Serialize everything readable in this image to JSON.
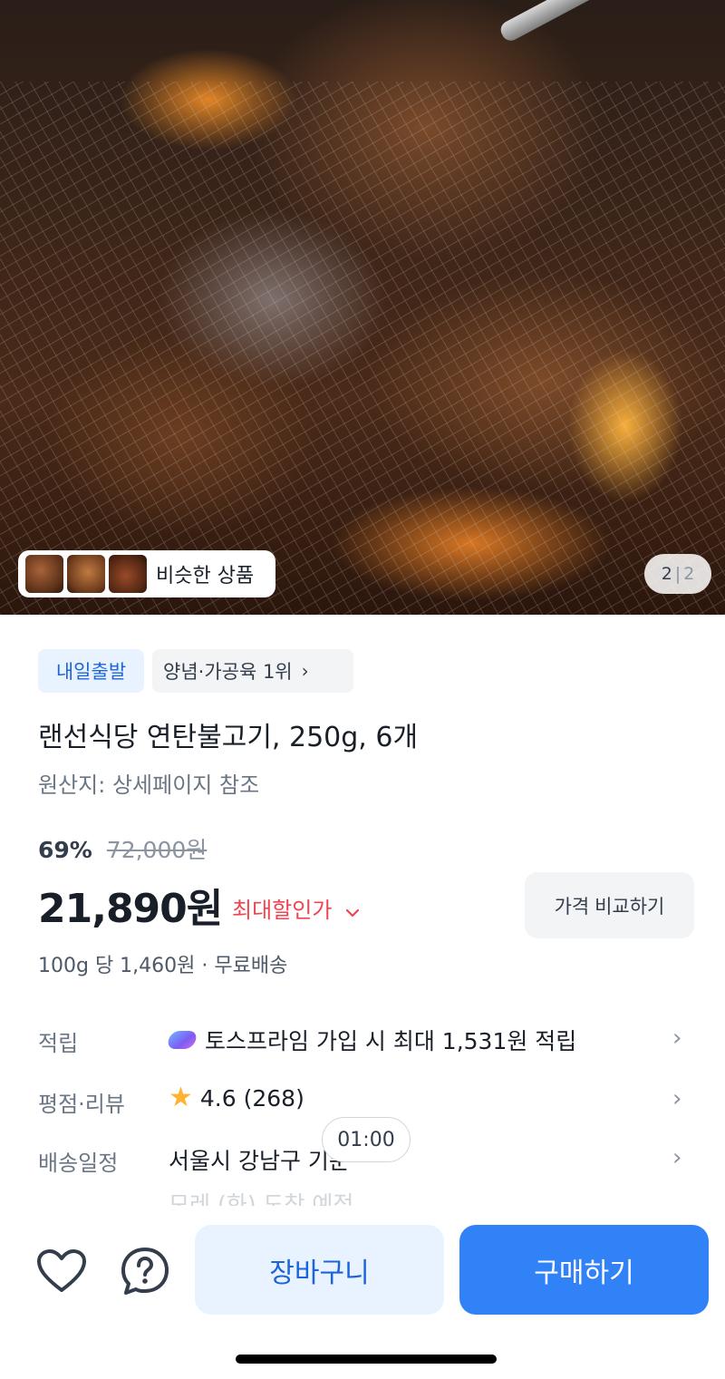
{
  "gallery": {
    "similar_label": "비슷한 상품",
    "page_current": "2",
    "page_total": "2"
  },
  "tags": {
    "shipping": "내일출발",
    "rank": "양념·가공육 1위"
  },
  "product": {
    "title": "랜선식당 연탄불고기, 250g, 6개",
    "origin": "원산지: 상세페이지 참조",
    "discount_pct": "69%",
    "original_price": "72,000원",
    "price": "21,890원",
    "max_discount_label": "최대할인가",
    "compare_label": "가격 비교하기",
    "unit_price": "100g 당 1,460원 · 무료배송"
  },
  "details": {
    "points_label": "적립",
    "points_value": "토스프라임 가입 시 최대 1,531원 적립",
    "rating_label": "평점·리뷰",
    "rating_value": "4.6 (268)",
    "delivery_label": "배송일정",
    "delivery_value": "서울시 강남구 기준",
    "delivery_sub": "모레 (화) 도착 예정"
  },
  "timer": "01:00",
  "actions": {
    "cart": "장바구니",
    "buy": "구매하기"
  },
  "colors": {
    "accent": "#3182f6",
    "accent_light": "#e8f3ff",
    "sale_red": "#f04452",
    "star": "#ffb331"
  },
  "icons": [
    "heart-icon",
    "question-icon",
    "chevron-right-icon",
    "chevron-down-icon",
    "star-icon",
    "prime-icon"
  ]
}
